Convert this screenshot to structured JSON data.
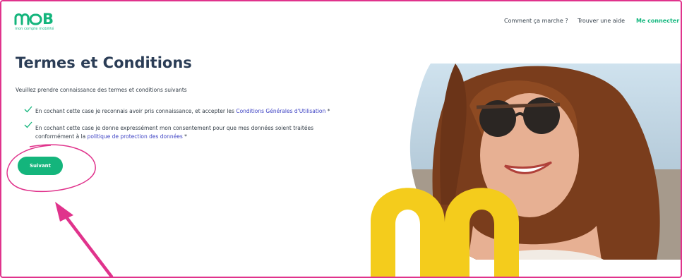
{
  "header": {
    "logo_text": "moB",
    "tagline": "mon compte mobilité",
    "nav": {
      "how_it_works": "Comment ça marche ?",
      "find_help": "Trouver une aide",
      "login": "Me connecter"
    }
  },
  "main": {
    "title": "Termes et Conditions",
    "intro": "Veuillez prendre connaissance des termes et conditions suivants",
    "terms": [
      {
        "checked": true,
        "text_before": "En cochant cette case je reconnais avoir pris connaissance, et accepter les ",
        "link": "Conditions Générales d'Utilisation",
        "text_after": " *"
      },
      {
        "checked": true,
        "text_before": "En cochant cette case je donne expressément mon consentement pour que mes données soient traitées conformément à la ",
        "link": "politique de protection des données",
        "text_after": " *"
      }
    ],
    "next_button": "Suivant"
  },
  "colors": {
    "brand_green": "#14b57c",
    "title": "#2b3d56",
    "link": "#3e43c4",
    "annotation_pink": "#e0338c",
    "hero_yellow": "#f4cc1c"
  },
  "icons": [
    "mob-logo",
    "check-icon",
    "annotation-circle",
    "annotation-arrow",
    "hero-photo",
    "brand-m-shape"
  ]
}
